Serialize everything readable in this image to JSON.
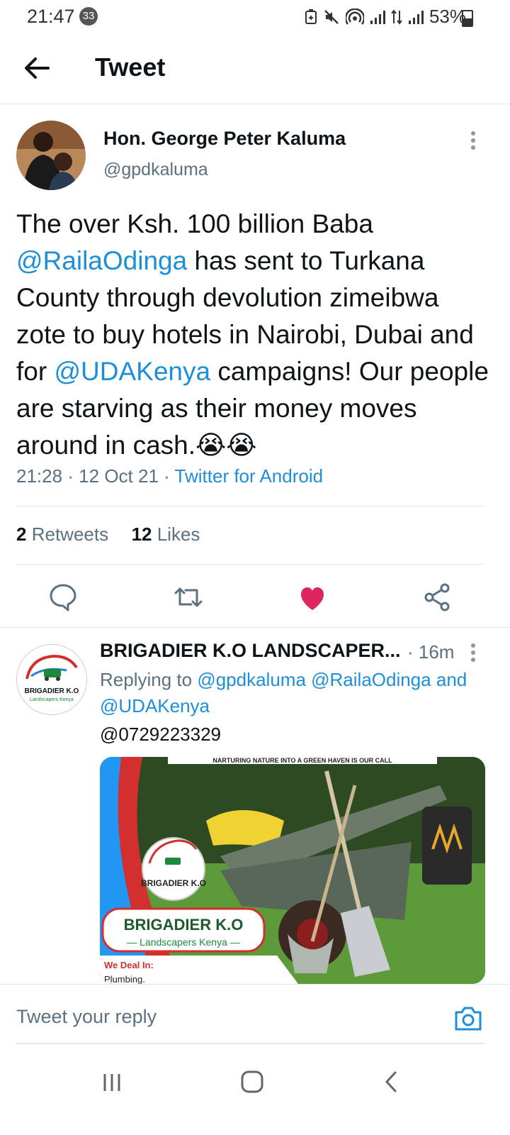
{
  "status_bar": {
    "time": "21:47",
    "notif_count": "33",
    "battery": "53%"
  },
  "header": {
    "title": "Tweet"
  },
  "tweet": {
    "author_name": "Hon. George Peter Kaluma",
    "author_handle": "@gpdkaluma",
    "text_1": "The over Ksh. 100 billion Baba ",
    "mention_1": "@RailaOdinga",
    "text_2": " has sent to Turkana County through devolution zimeibwa zote to buy hotels in Nairobi, Dubai and for ",
    "mention_2": "@UDAKenya",
    "text_3": " campaigns! Our people are starving as their money moves around in cash.",
    "emoji": "😭😭",
    "timestamp": "21:28 · 12 Oct 21 · ",
    "source": "Twitter for Android",
    "retweets_count": "2",
    "retweets_label": "Retweets",
    "likes_count": "12",
    "likes_label": "Likes"
  },
  "reply": {
    "author_name": "BRIGADIER K.O LANDSCAPER...",
    "time": "· 16m",
    "replying_prefix": "Replying to ",
    "replying_to_1": "@gpdkaluma",
    "replying_to_2": "@RailaOdinga",
    "replying_and": "and",
    "replying_to_3": "@UDAKenya",
    "text": "@0729223329",
    "avatar_logo_title": "BRIGADIER K.O",
    "avatar_logo_sub": "Landscapers Kenya",
    "media": {
      "banner": "NARTURING NATURE INTO A GREEN HAVEN IS OUR CALL",
      "logo_title": "BRIGADIER K.O",
      "brand_title": "BRIGADIER K.O",
      "brand_sub": "— Landscapers Kenya —",
      "deal_label": "We Deal In:",
      "deal_item": "Plumbing."
    }
  },
  "compose": {
    "placeholder": "Tweet your reply"
  },
  "colors": {
    "link": "#1d8fd8",
    "like": "#e0245e",
    "text": "#0f1419",
    "secondary": "#5b7083"
  }
}
